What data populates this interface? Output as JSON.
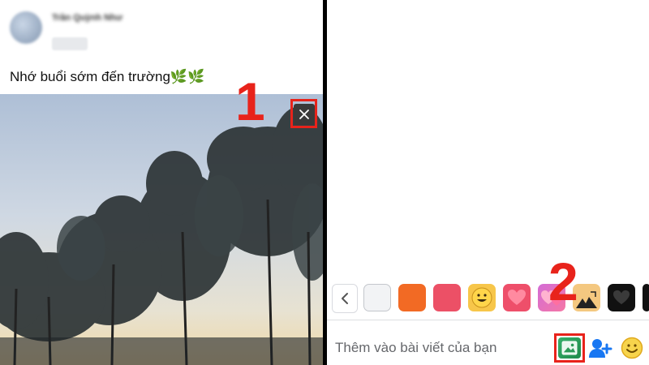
{
  "post": {
    "author": "Trần Quỳnh Như",
    "text": "Nhớ buổi sớm đến trường🌿🌿"
  },
  "annotations": {
    "step1": "1",
    "step2": "2",
    "highlight_color": "#e8231b"
  },
  "composer": {
    "background_swatches": [
      "white",
      "orange",
      "pink",
      "smiley-face",
      "heart",
      "hearts",
      "sketch",
      "black-heart",
      "black"
    ],
    "add_to_post_label": "Thêm vào bài viết của bạn",
    "icons": [
      "photo-icon",
      "tag-people-icon",
      "feeling-emoji-icon"
    ]
  }
}
